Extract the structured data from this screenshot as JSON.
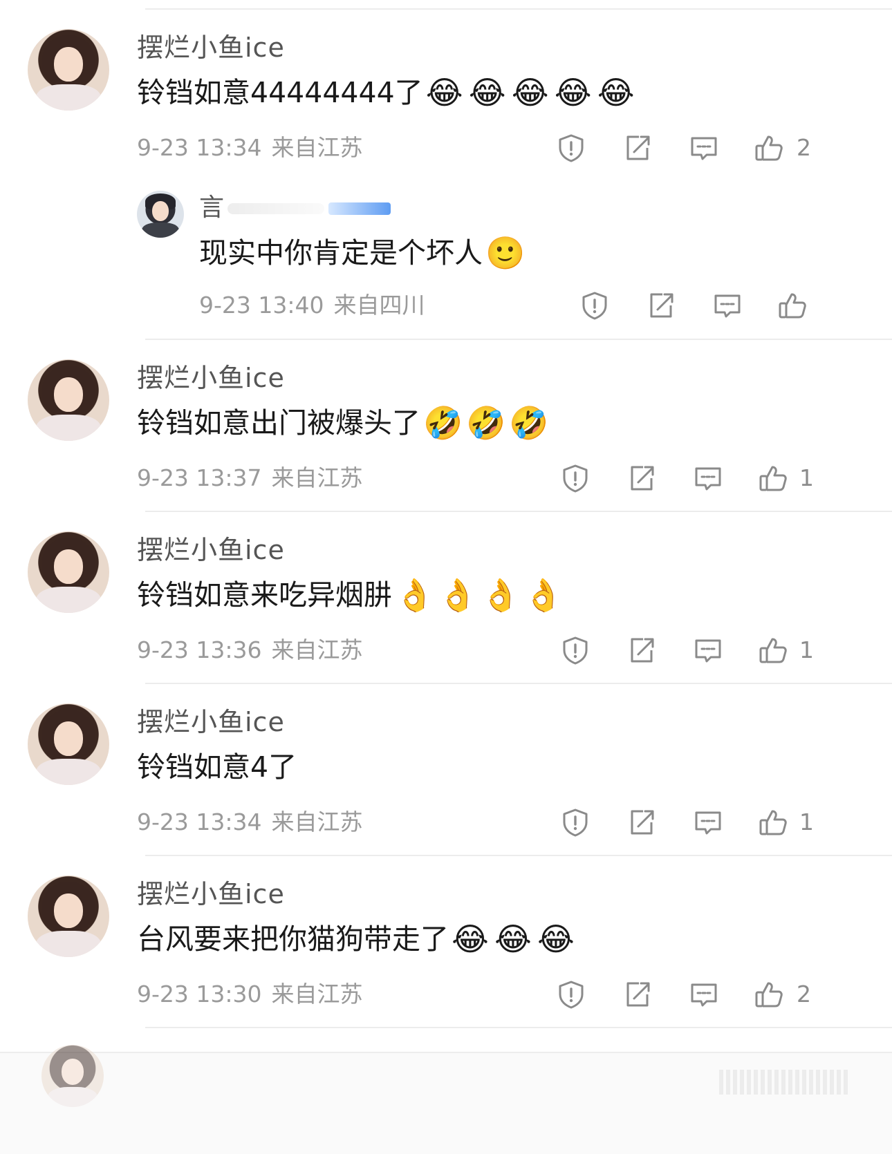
{
  "comments": [
    {
      "username": "摆烂小鱼ice",
      "content": "铃铛如意44444444了",
      "emojis": [
        "😂",
        "😂",
        "😂",
        "😂",
        "😂"
      ],
      "time": "9-23 13:34",
      "location": "来自江苏",
      "likes": "2"
    },
    {
      "username": "摆烂小鱼ice",
      "content": "铃铛如意出门被爆头了",
      "emojis": [
        "🤣",
        "🤣",
        "🤣"
      ],
      "time": "9-23 13:37",
      "location": "来自江苏",
      "likes": "1"
    },
    {
      "username": "摆烂小鱼ice",
      "content": "铃铛如意来吃异烟肼",
      "emojis": [
        "👌",
        "👌",
        "👌",
        "👌"
      ],
      "time": "9-23 13:36",
      "location": "来自江苏",
      "likes": "1"
    },
    {
      "username": "摆烂小鱼ice",
      "content": "铃铛如意4了",
      "emojis": [],
      "time": "9-23 13:34",
      "location": "来自江苏",
      "likes": "1"
    },
    {
      "username": "摆烂小鱼ice",
      "content": "台风要来把你猫狗带走了",
      "emojis": [
        "😂",
        "😂",
        "😂"
      ],
      "time": "9-23 13:30",
      "location": "来自江苏",
      "likes": "2"
    }
  ],
  "reply": {
    "username": "言",
    "content": "现实中你肯定是个坏人",
    "emojis": [
      "🙂"
    ],
    "time": "9-23 13:40",
    "location": "来自四川",
    "likes": ""
  },
  "colors": {
    "text": "#1a1a1a",
    "meta": "#9a9a9a",
    "icon": "#8a8a8a",
    "divider": "#ececec"
  },
  "icons": [
    "report-icon",
    "repost-icon",
    "comment-icon",
    "like-icon"
  ]
}
